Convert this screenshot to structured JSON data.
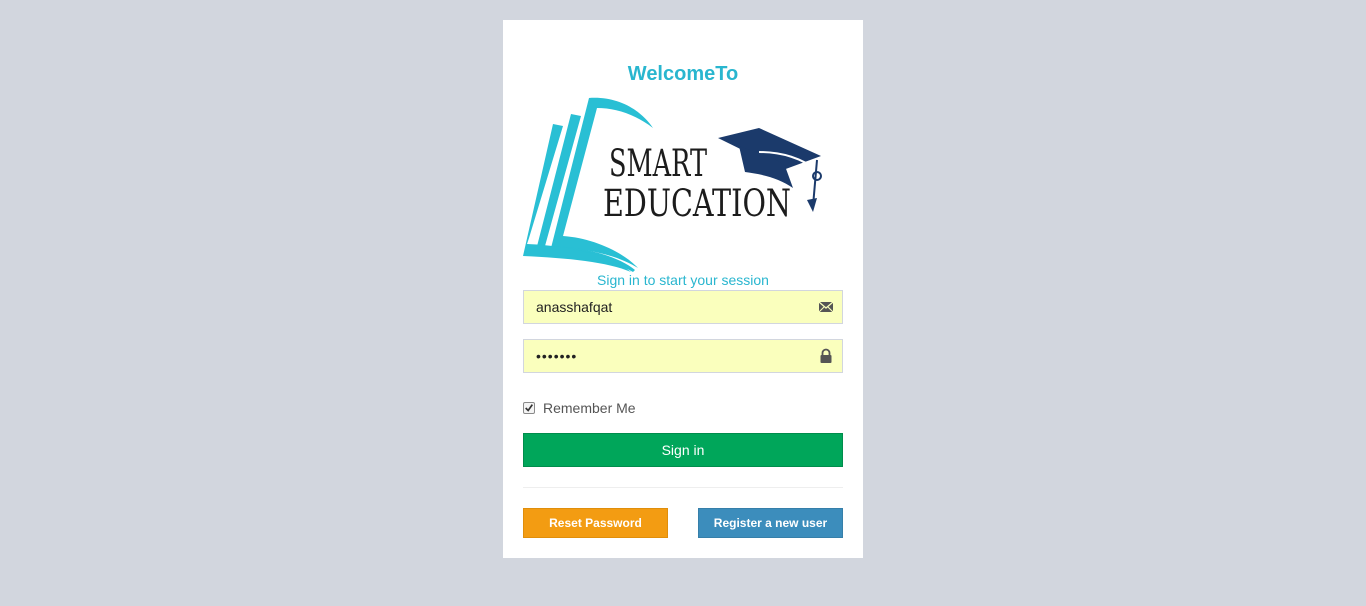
{
  "header": {
    "welcome": "WelcomeTo"
  },
  "logo": {
    "line1": "SMART",
    "line2": "EDUCATION",
    "book_color": "#29bfd4",
    "cap_color": "#1b3a6b",
    "text_color": "#1c1c1c"
  },
  "subtitle": "Sign in to start your session",
  "form": {
    "username": {
      "value": "anasshafqat",
      "icon": "envelope-icon"
    },
    "password": {
      "value": "•••••••",
      "icon": "lock-icon"
    },
    "remember": {
      "label": "Remember Me",
      "checked": true
    },
    "signin_label": "Sign in"
  },
  "footer": {
    "reset_label": "Reset Password",
    "register_label": "Register a new user"
  },
  "colors": {
    "background": "#d2d6de",
    "accent": "#29b6cf",
    "signin": "#00a65a",
    "reset": "#f39c12",
    "register": "#3c8dbc",
    "autofill": "#faffbd"
  }
}
